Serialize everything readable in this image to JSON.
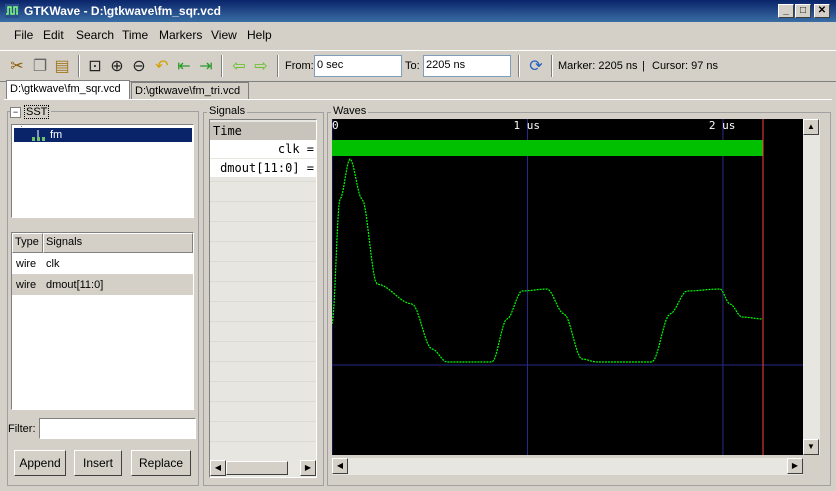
{
  "window": {
    "title": "GTKWave - D:\\gtkwave\\fm_sqr.vcd"
  },
  "menu": [
    "File",
    "Edit",
    "Search",
    "Time",
    "Markers",
    "View",
    "Help"
  ],
  "toolbar": {
    "from_label": "From:",
    "from_value": "0 sec",
    "to_label": "To:",
    "to_value": "2205 ns",
    "marker_text": "Marker: 2205 ns",
    "cursor_text": "Cursor: 97 ns",
    "divider": "|"
  },
  "tabs": [
    "D:\\gtkwave\\fm_sqr.vcd",
    "D:\\gtkwave\\fm_tri.vcd"
  ],
  "sst": {
    "label": "SST",
    "tree_item": "fm",
    "columns": {
      "type": "Type",
      "signals": "Signals"
    },
    "rows": [
      {
        "type": "wire",
        "name": "clk"
      },
      {
        "type": "wire",
        "name": "dmout[11:0]"
      }
    ],
    "filter_label": "Filter:",
    "filter_value": "",
    "buttons": {
      "append": "Append",
      "insert": "Insert",
      "replace": "Replace"
    }
  },
  "signals_panel": {
    "label": "Signals",
    "header": "Time",
    "items": [
      "clk =",
      "dmout[11:0] ="
    ]
  },
  "waves": {
    "label": "Waves",
    "ticks": [
      {
        "label": "0",
        "t": 0
      },
      {
        "label": "1 us",
        "t": 1000
      },
      {
        "label": "2 us",
        "t": 2000
      }
    ],
    "t_max": 2205,
    "colors": {
      "background": "#000000",
      "clk": "#00c000",
      "trace": "#00ff00",
      "grid": "#2a2a8a",
      "marker": "#ff4040"
    }
  }
}
